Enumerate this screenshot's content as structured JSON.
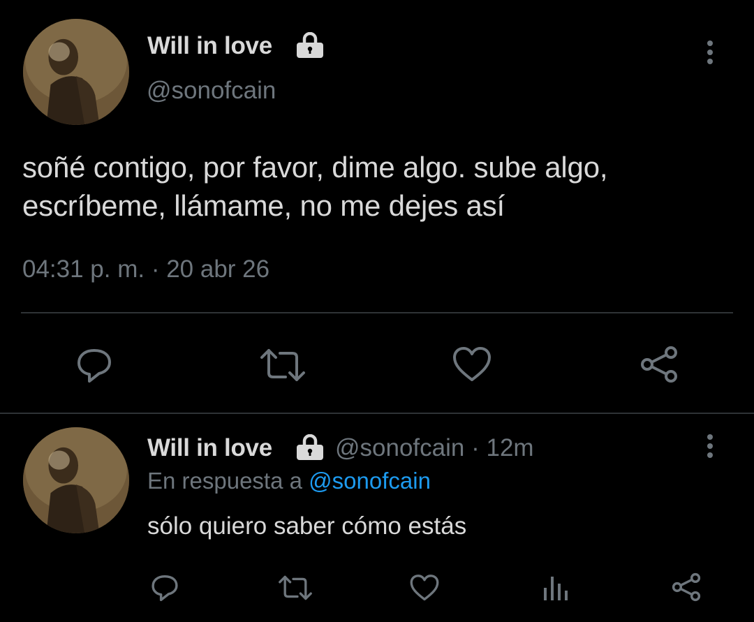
{
  "main_tweet": {
    "display_name": "Will in love",
    "handle": "@sonofcain",
    "text": "soñé contigo, por favor, dime algo. sube algo, escríbeme, llámame, no me dejes así",
    "timestamp": "04:31 p. m. · 20 abr 26",
    "icons": [
      "lock-icon",
      "more-vertical-icon",
      "reply-icon",
      "retweet-icon",
      "like-icon",
      "share-icon"
    ]
  },
  "reply_tweet": {
    "display_name": "Will in love",
    "handle": "@sonofcain",
    "separator": "·",
    "age": "12m",
    "reply_prefix": "En respuesta a",
    "reply_to_handle": "@sonofcain",
    "text": "sólo quiero saber cómo estás",
    "icons": [
      "lock-icon",
      "more-vertical-icon",
      "reply-icon",
      "retweet-icon",
      "like-icon",
      "analytics-icon",
      "share-icon"
    ]
  },
  "colors": {
    "background": "#000000",
    "text_primary": "#d9d9d9",
    "text_secondary": "#6e767d",
    "link": "#1d9bf0",
    "divider": "#2f3336"
  }
}
